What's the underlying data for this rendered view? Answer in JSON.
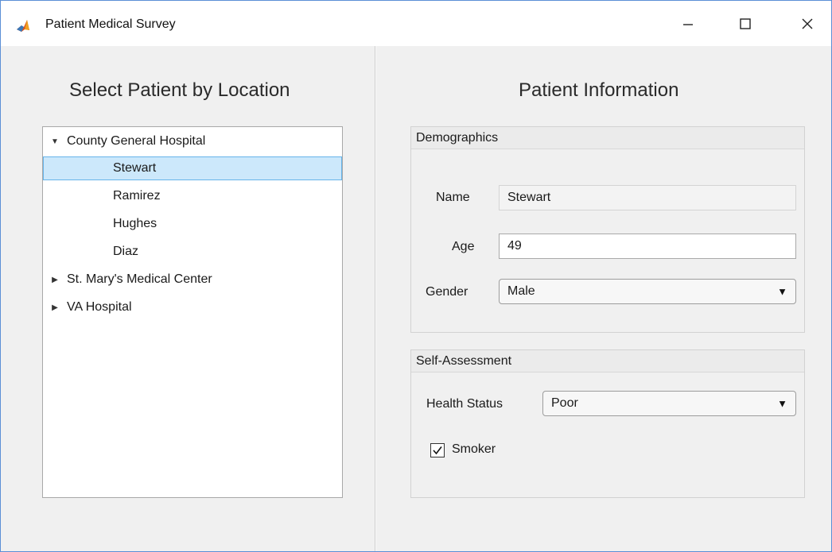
{
  "window": {
    "title": "Patient Medical Survey",
    "app_icon": "matlab-icon",
    "controls": [
      "minimize-icon",
      "maximize-icon",
      "close-icon"
    ]
  },
  "left_pane": {
    "heading": "Select Patient by Location",
    "tree": [
      {
        "label": "County General Hospital",
        "expanded": true,
        "children": [
          "Stewart",
          "Ramirez",
          "Hughes",
          "Diaz"
        ]
      },
      {
        "label": "St. Mary's Medical Center",
        "expanded": false
      },
      {
        "label": "VA Hospital",
        "expanded": false
      }
    ],
    "selected": "Stewart"
  },
  "right_pane": {
    "heading": "Patient Information",
    "demographics": {
      "title": "Demographics",
      "name_label": "Name",
      "name_value": "Stewart",
      "age_label": "Age",
      "age_value": "49",
      "gender_label": "Gender",
      "gender_value": "Male"
    },
    "self_assessment": {
      "title": "Self-Assessment",
      "health_label": "Health Status",
      "health_value": "Poor",
      "smoker_label": "Smoker",
      "smoker_checked": true
    }
  },
  "colors": {
    "selection_fill": "#cce8fb",
    "selection_border": "#66b4ea",
    "window_border": "#5b8fd6"
  }
}
